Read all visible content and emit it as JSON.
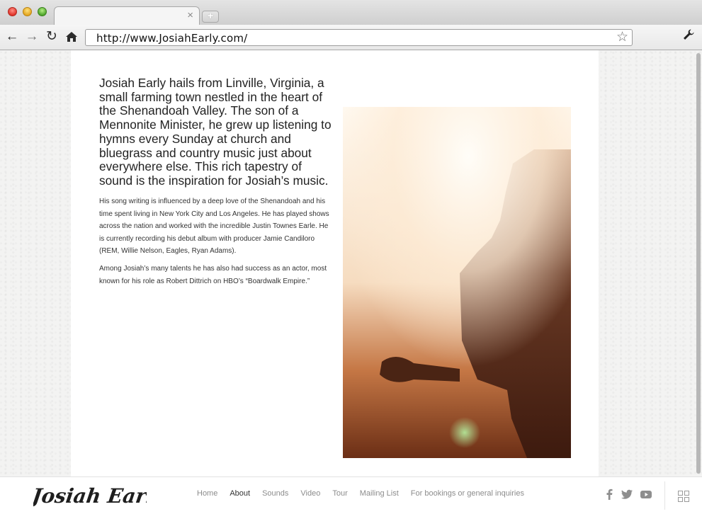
{
  "browser": {
    "url": "http://www.JosiahEarly.com/",
    "tab_close": "×",
    "new_tab": "+"
  },
  "content": {
    "lead": "Josiah Early hails from Linville, Virginia, a small farming town nestled in the heart of the Shenandoah Valley. The son of a Mennonite Minister, he grew up listening to hymns every Sunday at church and bluegrass and country music just about everywhere else. This rich tapestry of sound is the inspiration for Josiah’s music.",
    "p1": "His song writing is influenced by a deep love of the Shenandoah and his time spent living in New York City and Los Angeles. He has played shows across the nation and worked with the incredible Justin Townes Earle. He is currently recording his debut album with producer Jamie Candiloro (REM, Willie Nelson, Eagles, Ryan Adams).",
    "p2": "Among Josiah’s many talents he has also had success as an actor, most known for his role as Robert Dittrich on HBO’s “Boardwalk Empire.”"
  },
  "footer": {
    "logo_text": "Josiah Early",
    "nav": [
      {
        "label": "Home"
      },
      {
        "label": "About",
        "active": true
      },
      {
        "label": "Sounds"
      },
      {
        "label": "Video"
      },
      {
        "label": "Tour"
      },
      {
        "label": "Mailing List"
      },
      {
        "label": "For bookings or general inquiries"
      }
    ],
    "social_icons": [
      "facebook-icon",
      "twitter-icon",
      "youtube-icon"
    ],
    "menu_icon": "grid-icon"
  },
  "colors": {
    "accent_text": "#222222",
    "nav_inactive": "#8c8c8c",
    "nav_active": "#333333"
  }
}
